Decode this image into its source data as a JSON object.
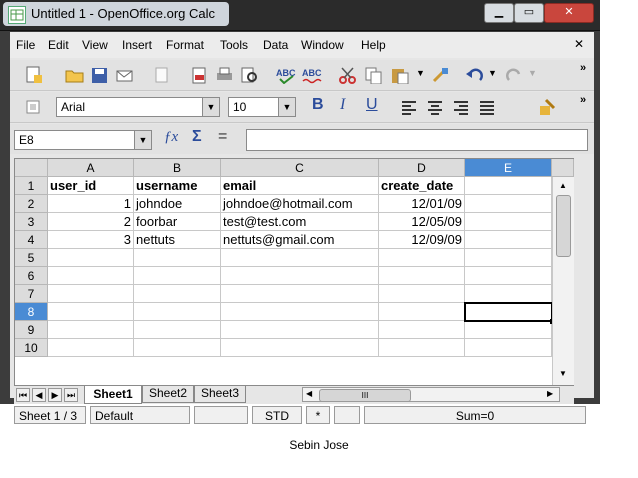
{
  "window": {
    "title": "Untitled 1 - OpenOffice.org Calc"
  },
  "window_controls": {
    "minimize": "▁",
    "maximize": "▭",
    "close": "✕"
  },
  "menu": {
    "items": [
      "File",
      "Edit",
      "View",
      "Insert",
      "Format",
      "Tools",
      "Data",
      "Window",
      "Help"
    ],
    "close_doc": "✕"
  },
  "formatting": {
    "font_name": "Arial",
    "font_size": "10"
  },
  "formula_bar": {
    "cell_ref": "E8",
    "function_glyph": "ƒx",
    "sum_glyph": "Σ",
    "equals_glyph": "=",
    "value": ""
  },
  "columns": [
    "A",
    "B",
    "C",
    "D",
    "E"
  ],
  "rows": [
    {
      "num": "1",
      "cells": [
        "user_id",
        "username",
        "email",
        "create_date",
        ""
      ]
    },
    {
      "num": "2",
      "cells": [
        "1",
        "johndoe",
        "johndoe@hotmail.com",
        "12/01/09",
        ""
      ]
    },
    {
      "num": "3",
      "cells": [
        "2",
        "foorbar",
        "test@test.com",
        "12/05/09",
        ""
      ]
    },
    {
      "num": "4",
      "cells": [
        "3",
        "nettuts",
        "nettuts@gmail.com",
        "12/09/09",
        ""
      ]
    },
    {
      "num": "5",
      "cells": [
        "",
        "",
        "",
        "",
        ""
      ]
    },
    {
      "num": "6",
      "cells": [
        "",
        "",
        "",
        "",
        ""
      ]
    },
    {
      "num": "7",
      "cells": [
        "",
        "",
        "",
        "",
        ""
      ]
    },
    {
      "num": "8",
      "cells": [
        "",
        "",
        "",
        "",
        ""
      ]
    },
    {
      "num": "9",
      "cells": [
        "",
        "",
        "",
        "",
        ""
      ]
    },
    {
      "num": "10",
      "cells": [
        "",
        "",
        "",
        "",
        ""
      ]
    }
  ],
  "selected_cell": {
    "col": "E",
    "row": "8"
  },
  "sheets": {
    "tabs": [
      "Sheet1",
      "Sheet2",
      "Sheet3"
    ],
    "active": "Sheet1"
  },
  "hscroll": {
    "thumb_label": "III"
  },
  "status_bar": {
    "sheet": "Sheet 1 / 3",
    "page_style": "Default",
    "mode": "STD",
    "modified": "*",
    "sum": "Sum=0"
  },
  "caption": "Sebin  Jose",
  "colors": {
    "accent": "#3b73b9",
    "header_bg": "#dcdcdc",
    "selected_header": "#4a8bd4"
  }
}
